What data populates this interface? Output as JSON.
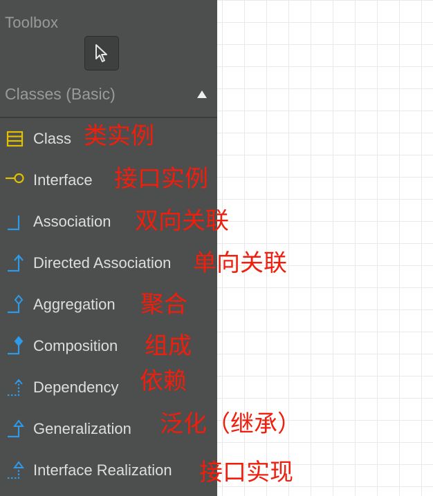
{
  "toolbox": {
    "title": "Toolbox",
    "pointer_icon": "arrow-pointer-icon",
    "section": {
      "title": "Classes (Basic)",
      "arrow_icon": "triangle-up-icon"
    },
    "items": [
      {
        "label": "Class",
        "icon": "class-icon",
        "annotation": "类实例"
      },
      {
        "label": "Interface",
        "icon": "interface-icon",
        "annotation": "接口实例"
      },
      {
        "label": "Association",
        "icon": "association-icon",
        "annotation": "双向关联"
      },
      {
        "label": "Directed Association",
        "icon": "directed-association-icon",
        "annotation": "单向关联"
      },
      {
        "label": "Aggregation",
        "icon": "aggregation-icon",
        "annotation": "聚合"
      },
      {
        "label": "Composition",
        "icon": "composition-icon",
        "annotation": "组成"
      },
      {
        "label": "Dependency",
        "icon": "dependency-icon",
        "annotation": "依赖"
      },
      {
        "label": "Generalization",
        "icon": "generalization-icon",
        "annotation": "泛化（继承）"
      },
      {
        "label": "Interface Realization",
        "icon": "interface-realization-icon",
        "annotation": "接口实现"
      }
    ]
  },
  "colors": {
    "panel_bg": "#4d4e4e",
    "label_text": "#dedede",
    "header_text": "#9a9a9a",
    "class_icon": "#e0c000",
    "relation_icon": "#2f9be8",
    "annotation_text": "#f01e0c"
  }
}
